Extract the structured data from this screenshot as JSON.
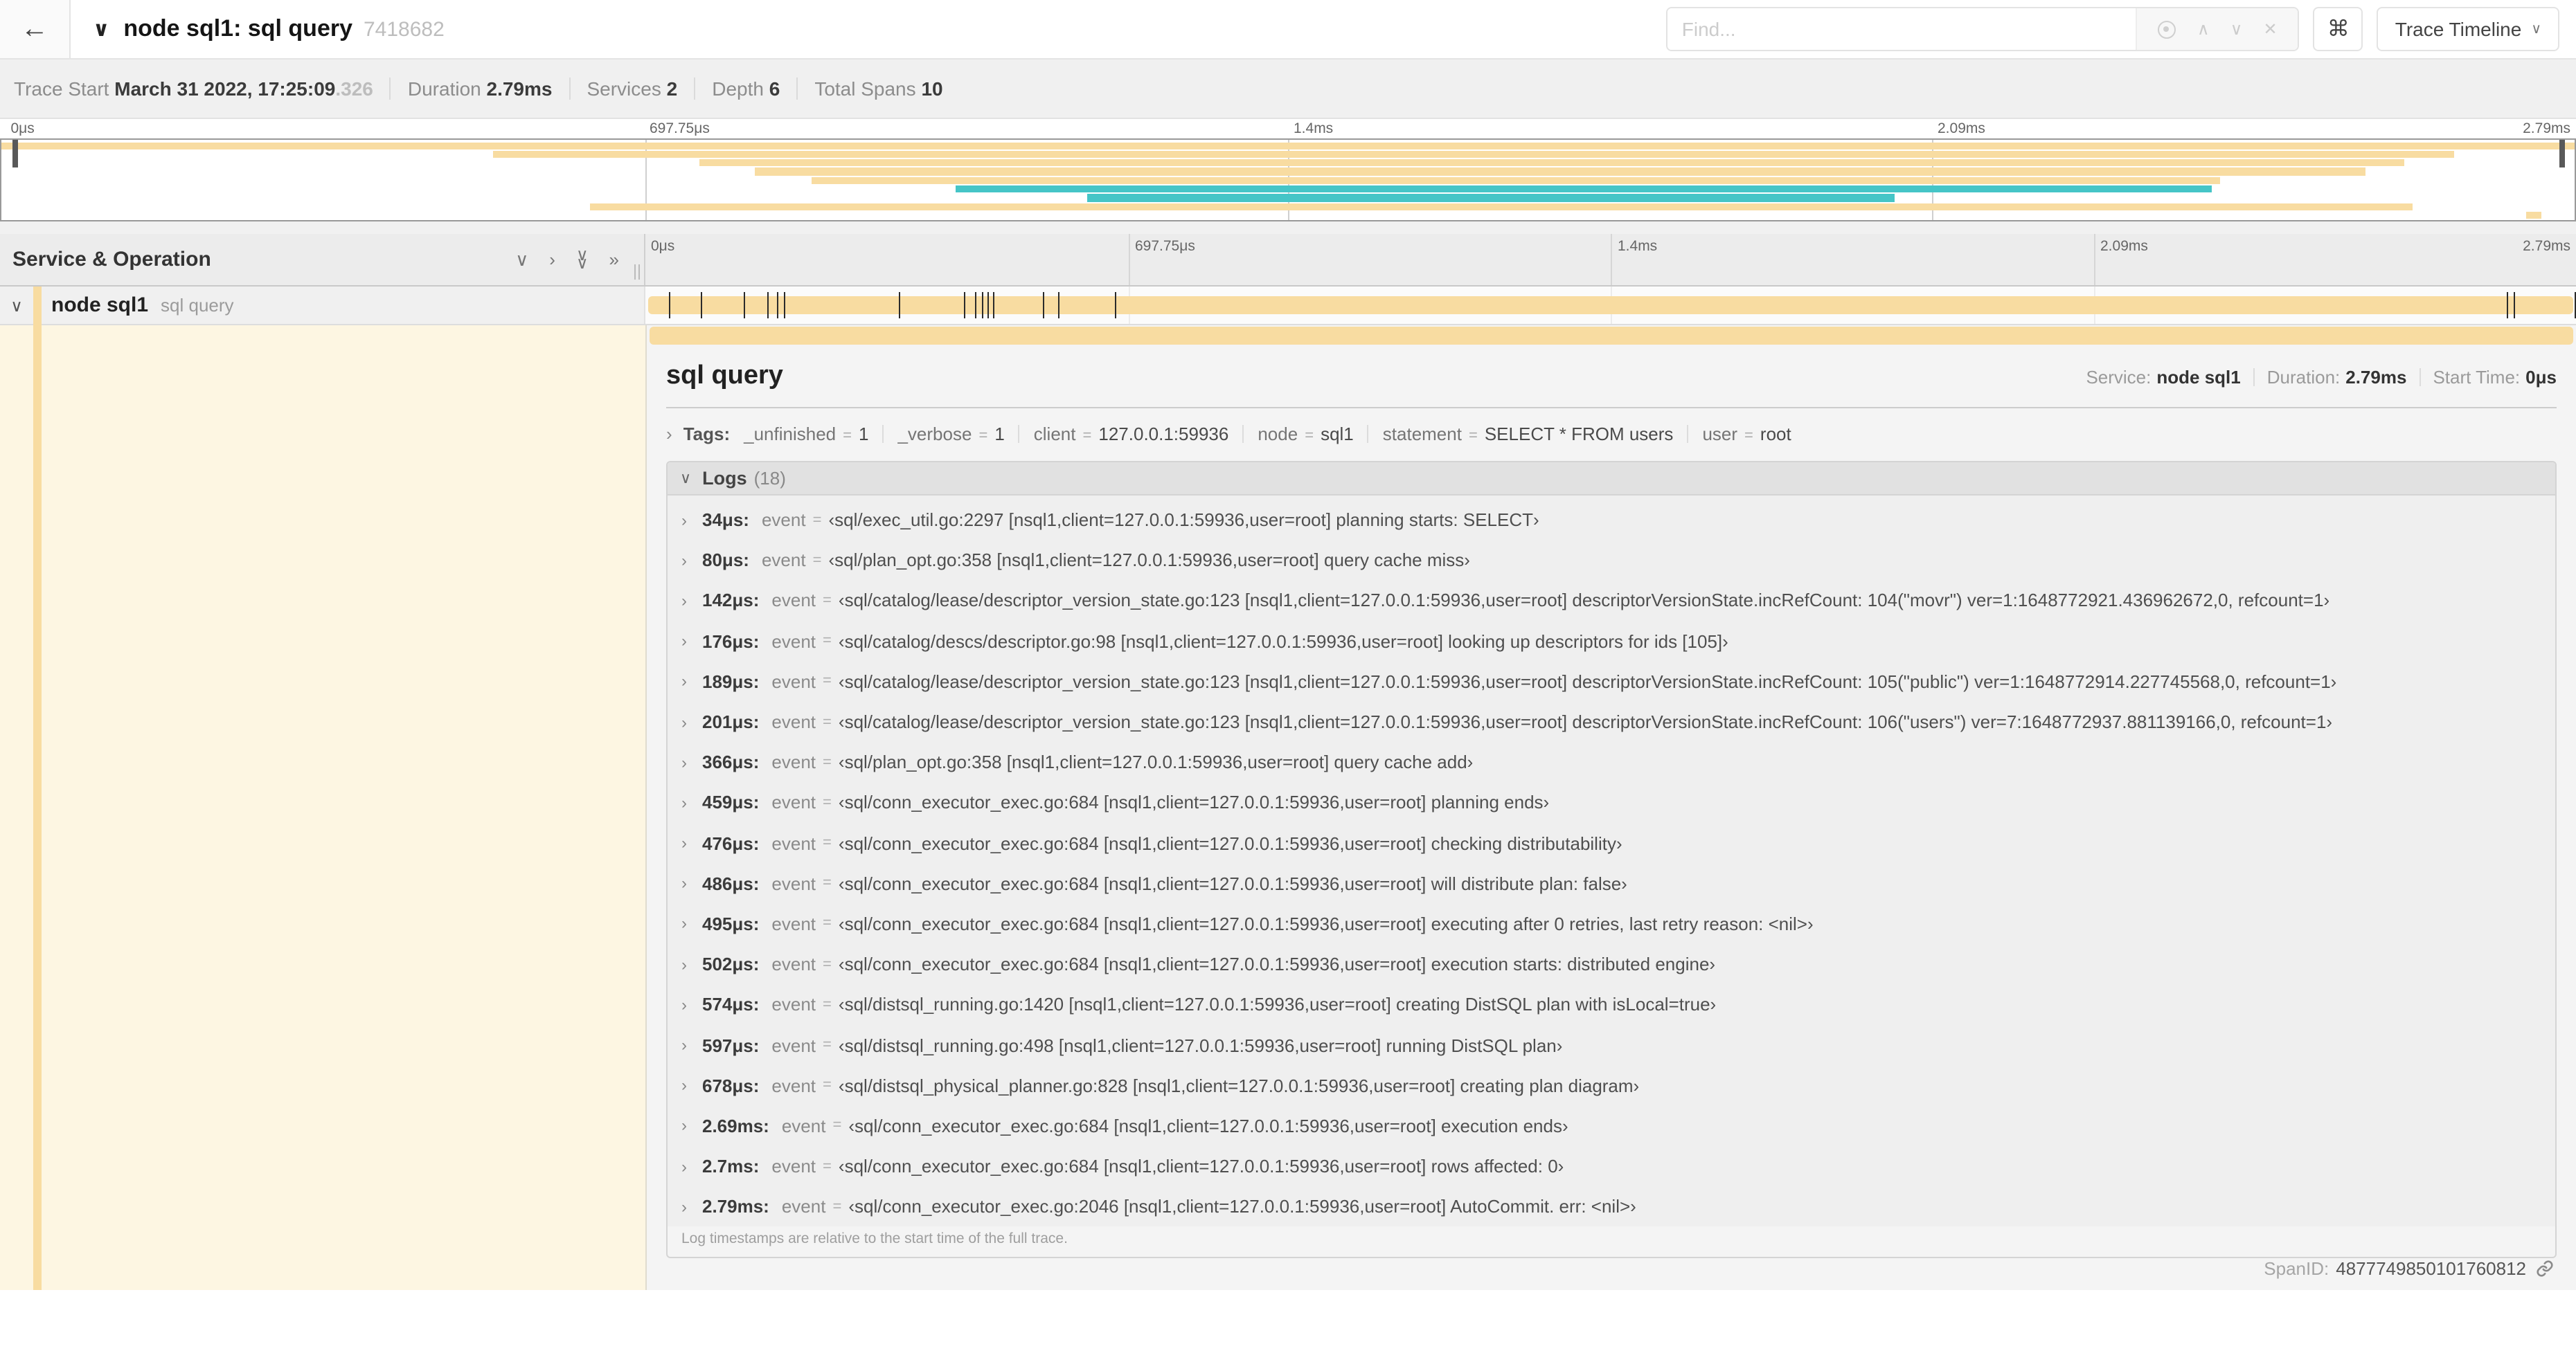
{
  "colors": {
    "span_tan": "#F8DCA1",
    "span_teal": "#45C5C7",
    "selected_row_bg": "#FDF6E2"
  },
  "header": {
    "back_glyph": "←",
    "title_chevron": "∨",
    "title": "node sql1: sql query",
    "trace_id_short": "7418682",
    "find_placeholder": "Find...",
    "clear_glyph": "✕",
    "prev_glyph": "∧",
    "next_glyph": "∨",
    "kbd_glyph": "⌘",
    "view_selector_label": "Trace Timeline",
    "view_selector_chevron": "∨"
  },
  "trace_info": {
    "items": [
      {
        "label": "Trace Start",
        "value": "March 31 2022, 17:25:09",
        "suffix": ".326"
      },
      {
        "label": "Duration",
        "value": "2.79ms"
      },
      {
        "label": "Services",
        "value": "2"
      },
      {
        "label": "Depth",
        "value": "6"
      },
      {
        "label": "Total Spans",
        "value": "10"
      }
    ]
  },
  "timeline": {
    "ruler_ticks": [
      "0μs",
      "697.75μs",
      "1.4ms",
      "2.09ms",
      "2.79ms"
    ],
    "left_header": "Service & Operation",
    "collapse_icons": [
      "chevron-down",
      "chevron-right",
      "double-chevron-down",
      "double-chevron-right"
    ],
    "row": {
      "chevron": "∨",
      "service": "node sql1",
      "operation": "sql query"
    }
  },
  "minimap_bars": [
    {
      "start": 0,
      "end": 100,
      "color": "tan"
    },
    {
      "start": 19.1,
      "end": 95.3,
      "color": "tan"
    },
    {
      "start": 27.1,
      "end": 93.4,
      "color": "tan"
    },
    {
      "start": 29.3,
      "end": 91.9,
      "color": "tan"
    },
    {
      "start": 31.5,
      "end": 86.2,
      "color": "tan"
    },
    {
      "start": 37.1,
      "end": 85.9,
      "color": "teal"
    },
    {
      "start": 42.2,
      "end": 73.6,
      "color": "teal"
    },
    {
      "start": 22.9,
      "end": 93.7,
      "color": "tan"
    },
    {
      "start": 98.1,
      "end": 98.7,
      "color": "tan"
    }
  ],
  "detail": {
    "title": "sql query",
    "overview": [
      {
        "label": "Service:",
        "value": "node sql1"
      },
      {
        "label": "Duration:",
        "value": "2.79ms"
      },
      {
        "label": "Start Time:",
        "value": "0μs"
      }
    ],
    "tags_chevron": "›",
    "tags_label": "Tags:",
    "tags": [
      {
        "key": "_unfinished",
        "value": "1"
      },
      {
        "key": "_verbose",
        "value": "1"
      },
      {
        "key": "client",
        "value": "127.0.0.1:59936"
      },
      {
        "key": "node",
        "value": "sql1"
      },
      {
        "key": "statement",
        "value": "SELECT * FROM users"
      },
      {
        "key": "user",
        "value": "root"
      }
    ],
    "logs_chevron": "∨",
    "logs_label": "Logs",
    "logs_count": "(18)",
    "logs": [
      {
        "time": "34μs:",
        "field": "event",
        "pct": 1.2,
        "value": "‹sql/exec_util.go:2297 [nsql1,client=127.0.0.1:59936,user=root] planning starts: SELECT›"
      },
      {
        "time": "80μs:",
        "field": "event",
        "pct": 2.9,
        "value": "‹sql/plan_opt.go:358 [nsql1,client=127.0.0.1:59936,user=root] query cache miss›"
      },
      {
        "time": "142μs:",
        "field": "event",
        "pct": 5.1,
        "value": "‹sql/catalog/lease/descriptor_version_state.go:123 [nsql1,client=127.0.0.1:59936,user=root] descriptorVersionState.incRefCount: 104(\"movr\") ver=1:1648772921.436962672,0, refcount=1›"
      },
      {
        "time": "176μs:",
        "field": "event",
        "pct": 6.3,
        "value": "‹sql/catalog/descs/descriptor.go:98 [nsql1,client=127.0.0.1:59936,user=root] looking up descriptors for ids [105]›"
      },
      {
        "time": "189μs:",
        "field": "event",
        "pct": 6.8,
        "value": "‹sql/catalog/lease/descriptor_version_state.go:123 [nsql1,client=127.0.0.1:59936,user=root] descriptorVersionState.incRefCount: 105(\"public\") ver=1:1648772914.227745568,0, refcount=1›"
      },
      {
        "time": "201μs:",
        "field": "event",
        "pct": 7.2,
        "value": "‹sql/catalog/lease/descriptor_version_state.go:123 [nsql1,client=127.0.0.1:59936,user=root] descriptorVersionState.incRefCount: 106(\"users\") ver=7:1648772937.881139166,0, refcount=1›"
      },
      {
        "time": "366μs:",
        "field": "event",
        "pct": 13.1,
        "value": "‹sql/plan_opt.go:358 [nsql1,client=127.0.0.1:59936,user=root] query cache add›"
      },
      {
        "time": "459μs:",
        "field": "event",
        "pct": 16.5,
        "value": "‹sql/conn_executor_exec.go:684 [nsql1,client=127.0.0.1:59936,user=root] planning ends›"
      },
      {
        "time": "476μs:",
        "field": "event",
        "pct": 17.1,
        "value": "‹sql/conn_executor_exec.go:684 [nsql1,client=127.0.0.1:59936,user=root] checking distributability›"
      },
      {
        "time": "486μs:",
        "field": "event",
        "pct": 17.4,
        "value": "‹sql/conn_executor_exec.go:684 [nsql1,client=127.0.0.1:59936,user=root] will distribute plan: false›"
      },
      {
        "time": "495μs:",
        "field": "event",
        "pct": 17.7,
        "value": "‹sql/conn_executor_exec.go:684 [nsql1,client=127.0.0.1:59936,user=root] executing after 0 retries, last retry reason: <nil>›"
      },
      {
        "time": "502μs:",
        "field": "event",
        "pct": 18.0,
        "value": "‹sql/conn_executor_exec.go:684 [nsql1,client=127.0.0.1:59936,user=root] execution starts: distributed engine›"
      },
      {
        "time": "574μs:",
        "field": "event",
        "pct": 20.6,
        "value": "‹sql/distsql_running.go:1420 [nsql1,client=127.0.0.1:59936,user=root] creating DistSQL plan with isLocal=true›"
      },
      {
        "time": "597μs:",
        "field": "event",
        "pct": 21.4,
        "value": "‹sql/distsql_running.go:498 [nsql1,client=127.0.0.1:59936,user=root] running DistSQL plan›"
      },
      {
        "time": "678μs:",
        "field": "event",
        "pct": 24.3,
        "value": "‹sql/distsql_physical_planner.go:828 [nsql1,client=127.0.0.1:59936,user=root] creating plan diagram›"
      },
      {
        "time": "2.69ms:",
        "field": "event",
        "pct": 96.4,
        "value": "‹sql/conn_executor_exec.go:684 [nsql1,client=127.0.0.1:59936,user=root] execution ends›"
      },
      {
        "time": "2.7ms:",
        "field": "event",
        "pct": 96.8,
        "value": "‹sql/conn_executor_exec.go:684 [nsql1,client=127.0.0.1:59936,user=root] rows affected: 0›"
      },
      {
        "time": "2.79ms:",
        "field": "event",
        "pct": 99.9,
        "value": "‹sql/conn_executor_exec.go:2046 [nsql1,client=127.0.0.1:59936,user=root] AutoCommit. err: <nil>›"
      }
    ],
    "note": "Log timestamps are relative to the start time of the full trace.",
    "span_id_label": "SpanID:",
    "span_id": "4877749850101760812"
  }
}
